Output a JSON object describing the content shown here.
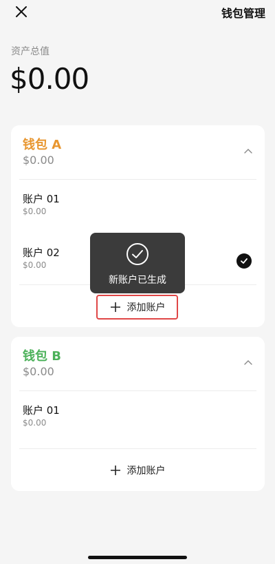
{
  "header": {
    "manage_label": "钱包管理"
  },
  "summary": {
    "label": "资产总值",
    "value": "$0.00"
  },
  "wallets": [
    {
      "name": "钱包 A",
      "balance": "$0.00",
      "accounts": [
        {
          "name": "账户 01",
          "balance": "$0.00",
          "selected": false
        },
        {
          "name": "账户 02",
          "balance": "$0.00",
          "selected": true
        }
      ],
      "add_label": "添加账户"
    },
    {
      "name": "钱包 B",
      "balance": "$0.00",
      "accounts": [
        {
          "name": "账户 01",
          "balance": "$0.00",
          "selected": false
        }
      ],
      "add_label": "添加账户"
    }
  ],
  "toast": {
    "message": "新账户已生成",
    "icon": "check-circle-icon"
  },
  "colors": {
    "wallet_a": "#e8962f",
    "wallet_b": "#4cb15a",
    "highlight": "#e04646",
    "toast_bg": "#3b3b3b"
  }
}
